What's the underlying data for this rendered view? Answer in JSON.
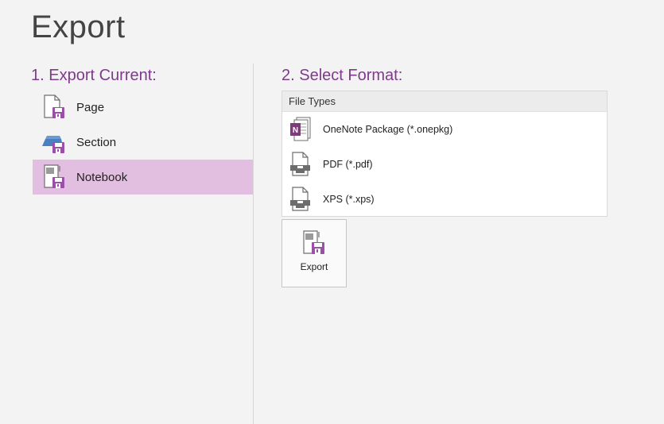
{
  "title": "Export",
  "export_current": {
    "heading": "1. Export Current:",
    "items": [
      {
        "label": "Page",
        "icon": "page-export-icon",
        "selected": false
      },
      {
        "label": "Section",
        "icon": "section-export-icon",
        "selected": false
      },
      {
        "label": "Notebook",
        "icon": "notebook-export-icon",
        "selected": true
      }
    ]
  },
  "select_format": {
    "heading": "2. Select Format:",
    "list_header": "File Types",
    "items": [
      {
        "label": "OneNote Package (*.onepkg)",
        "icon": "onenote-package-icon"
      },
      {
        "label": "PDF (*.pdf)",
        "icon": "pdf-document-icon"
      },
      {
        "label": "XPS (*.xps)",
        "icon": "xps-document-icon"
      }
    ]
  },
  "export_button": {
    "label": "Export",
    "icon": "export-icon"
  },
  "colors": {
    "accent": "#7f3a8c",
    "selected_bg": "#e2bfe0",
    "background": "#f3f3f3",
    "onenote_purple": "#80397b",
    "save_purple": "#9b4fa8"
  }
}
